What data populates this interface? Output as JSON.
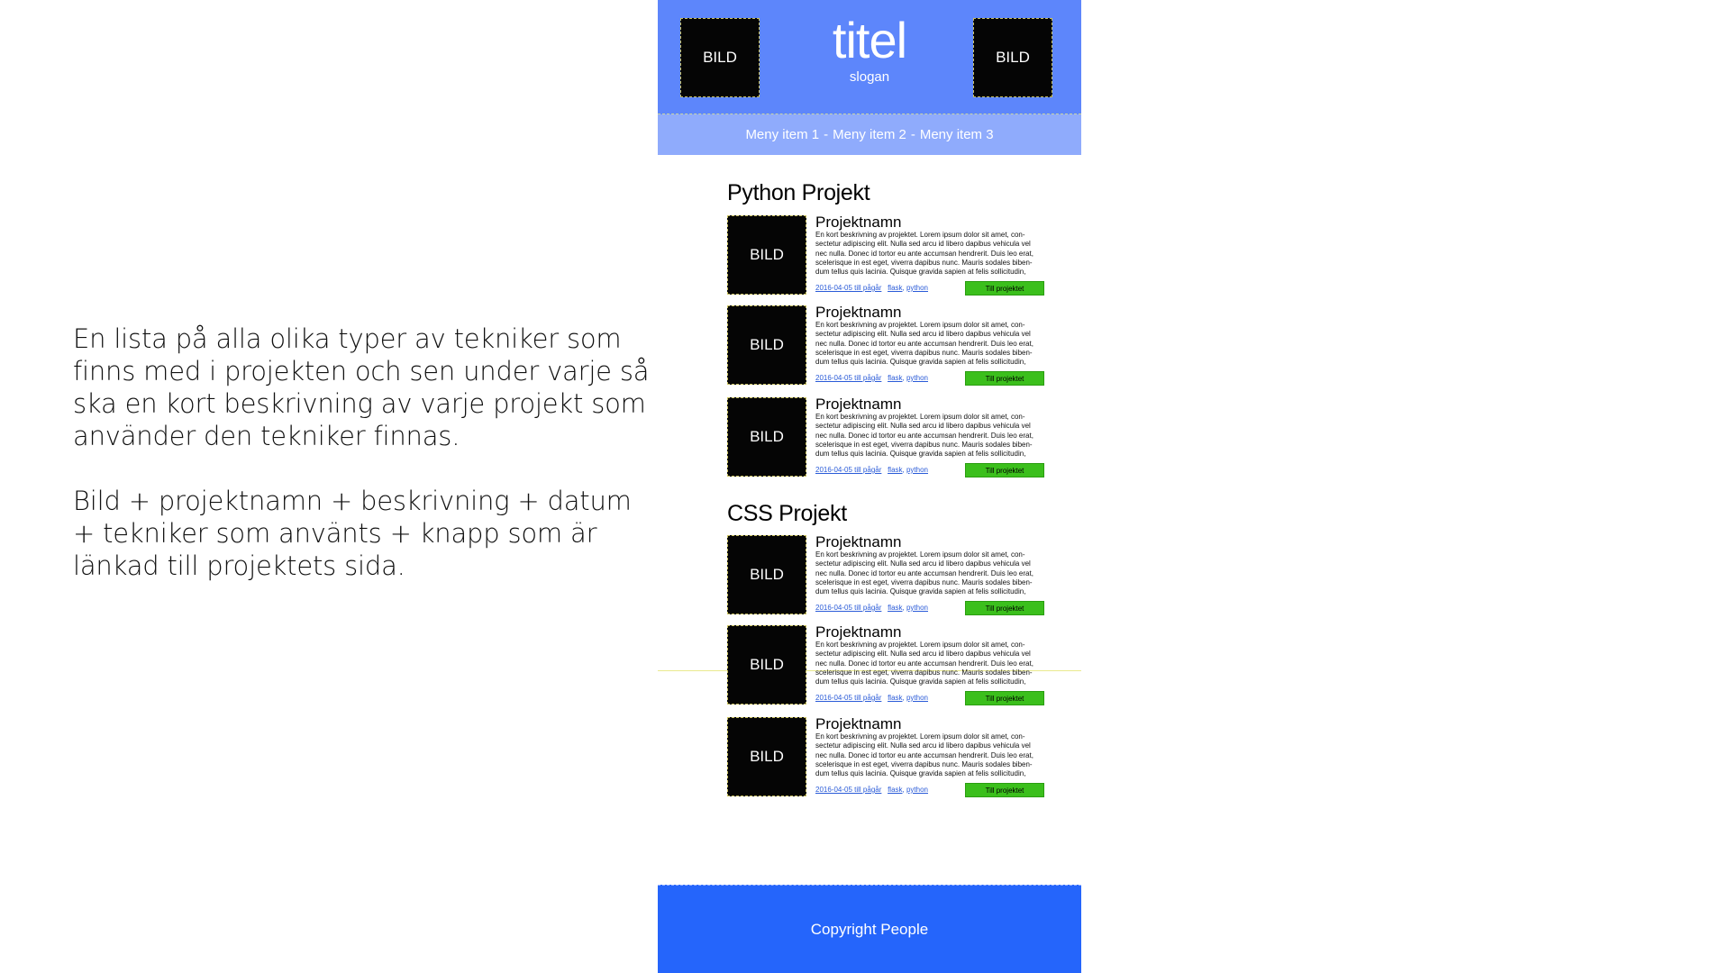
{
  "annotation": {
    "paragraph_1": "En lista på alla olika typer av tekniker som finns med i projekten och sen under varje så ska en kort beskrivning av varje projekt som använder den tekniker finnas.",
    "paragraph_2": "Bild + projektnamn + beskrivning + datum + tekniker som använts + knapp som är länkad till projektets sida."
  },
  "header": {
    "left_image": "BILD",
    "right_image": "BILD",
    "title": "titel",
    "slogan": "slogan",
    "background": "#5d86fb"
  },
  "menu": {
    "items": [
      "Meny item 1",
      "Meny item 2",
      "Meny item 3"
    ],
    "separator": "-",
    "background": "#8fabfc"
  },
  "sections": [
    {
      "title": "Python Projekt",
      "projects": [
        {
          "image": "BILD",
          "name": "Projektnamn",
          "description": "En kort beskrivning av projektet. Lorem ipsum dolor sit amet, con-\nsectetur adipiscing elit. Nulla sed arcu id libero dapibus vehicula vel\nnec nulla. Donec id tortor eu ante accumsan hendrerit. Duis leo erat,\nscelerisque in est eget, viverra dapibus nunc. Mauris sodales biben-\ndum tellus quis lacinia. Quisque gravida sapien at felis sollicitudin,",
          "date": "2016-04-05 till pågår",
          "tech_1": "flask",
          "tech_2": "python",
          "button": "Till projektet"
        },
        {
          "image": "BILD",
          "name": "Projektnamn",
          "description": "En kort beskrivning av projektet. Lorem ipsum dolor sit amet, con-\nsectetur adipiscing elit. Nulla sed arcu id libero dapibus vehicula vel\nnec nulla. Donec id tortor eu ante accumsan hendrerit. Duis leo erat,\nscelerisque in est eget, viverra dapibus nunc. Mauris sodales biben-\ndum tellus quis lacinia. Quisque gravida sapien at felis sollicitudin,",
          "date": "2016-04-05 till pågår",
          "tech_1": "flask",
          "tech_2": "python",
          "button": "Till projektet"
        },
        {
          "image": "BILD",
          "name": "Projektnamn",
          "description": "En kort beskrivning av projektet. Lorem ipsum dolor sit amet, con-\nsectetur adipiscing elit. Nulla sed arcu id libero dapibus vehicula vel\nnec nulla. Donec id tortor eu ante accumsan hendrerit. Duis leo erat,\nscelerisque in est eget, viverra dapibus nunc. Mauris sodales biben-\ndum tellus quis lacinia. Quisque gravida sapien at felis sollicitudin,",
          "date": "2016-04-05 till pågår",
          "tech_1": "flask",
          "tech_2": "python",
          "button": "Till projektet"
        }
      ]
    },
    {
      "title": "CSS Projekt",
      "projects": [
        {
          "image": "BILD",
          "name": "Projektnamn",
          "description": "En kort beskrivning av projektet. Lorem ipsum dolor sit amet, con-\nsectetur adipiscing elit. Nulla sed arcu id libero dapibus vehicula vel\nnec nulla. Donec id tortor eu ante accumsan hendrerit. Duis leo erat,\nscelerisque in est eget, viverra dapibus nunc. Mauris sodales biben-\ndum tellus quis lacinia. Quisque gravida sapien at felis sollicitudin,",
          "date": "2016-04-05 till pågår",
          "tech_1": "flask",
          "tech_2": "python",
          "button": "Till projektet"
        },
        {
          "image": "BILD",
          "name": "Projektnamn",
          "description": "En kort beskrivning av projektet. Lorem ipsum dolor sit amet, con-\nsectetur adipiscing elit. Nulla sed arcu id libero dapibus vehicula vel\nnec nulla. Donec id tortor eu ante accumsan hendrerit. Duis leo erat,\nscelerisque in est eget, viverra dapibus nunc. Mauris sodales biben-\ndum tellus quis lacinia. Quisque gravida sapien at felis sollicitudin,",
          "date": "2016-04-05 till pågår",
          "tech_1": "flask",
          "tech_2": "python",
          "button": "Till projektet"
        },
        {
          "image": "BILD",
          "name": "Projektnamn",
          "description": "En kort beskrivning av projektet. Lorem ipsum dolor sit amet, con-\nsectetur adipiscing elit. Nulla sed arcu id libero dapibus vehicula vel\nnec nulla. Donec id tortor eu ante accumsan hendrerit. Duis leo erat,\nscelerisque in est eget, viverra dapibus nunc. Mauris sodales biben-\ndum tellus quis lacinia. Quisque gravida sapien at felis sollicitudin,",
          "date": "2016-04-05 till pågår",
          "tech_1": "flask",
          "tech_2": "python",
          "button": "Till projektet"
        }
      ]
    }
  ],
  "footer": {
    "text": "Copyright People",
    "background": "#2565fb"
  },
  "colors": {
    "button": "#3bbf1c",
    "link": "#2a5bd8"
  }
}
